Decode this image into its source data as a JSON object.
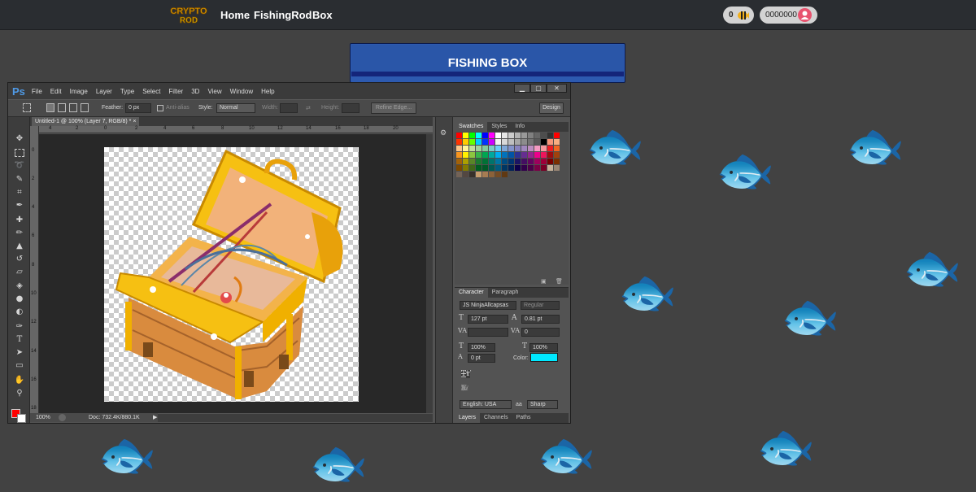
{
  "nav": {
    "logo_text": "CRYPTO ROD",
    "links": [
      "Home",
      "FishingRod",
      "Box"
    ],
    "fish_count": "0",
    "balance": "0000000"
  },
  "banner": {
    "title": "FISHING BOX"
  },
  "photoshop": {
    "logo": "Ps",
    "menu": [
      "File",
      "Edit",
      "Image",
      "Layer",
      "Type",
      "Select",
      "Filter",
      "3D",
      "View",
      "Window",
      "Help"
    ],
    "window_buttons": [
      "▁",
      "▢",
      "✕"
    ],
    "options": {
      "feather_label": "Feather:",
      "feather_value": "0 px",
      "antialias_label": "Anti-alias",
      "style_label": "Style:",
      "style_value": "Normal",
      "width_label": "Width:",
      "height_label": "Height:",
      "refine_button": "Refine Edge...",
      "workspace": "Design"
    },
    "doc_tab": "Untitled-1 @ 100% (Layer 7, RGB/8) *",
    "ruler_h": [
      "4",
      "2",
      "0",
      "2",
      "4",
      "6",
      "8",
      "10",
      "12",
      "14",
      "16",
      "18",
      "20"
    ],
    "ruler_v": [
      "0",
      "2",
      "4",
      "6",
      "8",
      "10",
      "12",
      "14",
      "16",
      "18"
    ],
    "status": {
      "zoom": "100%",
      "doc": "Doc: 732.4K/880.1K"
    },
    "swatches_tabs": [
      "Swatches",
      "Styles",
      "Info"
    ],
    "character_tabs": [
      "Character",
      "Paragraph"
    ],
    "character": {
      "font_family": "JS NinjaAllcapsas",
      "font_style": "Regular",
      "size": "127 pt",
      "leading": "0.81 pt",
      "kerning": "",
      "tracking": "0",
      "vscale": "100%",
      "hscale": "100%",
      "baseline": "0 pt",
      "color_label": "Color:",
      "color": "#00e8ff",
      "language": "English: USA",
      "antialias": "Sharp"
    },
    "layers_tabs": [
      "Layers",
      "Channels",
      "Paths"
    ],
    "swatch_colors": [
      "#ff0000",
      "#ffff00",
      "#00ff00",
      "#00ffff",
      "#0000ff",
      "#ff00ff",
      "#ffffff",
      "#e6e6e6",
      "#cccccc",
      "#b3b3b3",
      "#999999",
      "#808080",
      "#666666",
      "#4d4d4d",
      "#333333",
      "#ff0000",
      "#ff3300",
      "#ffcc00",
      "#66ff00",
      "#00ccff",
      "#0033ff",
      "#cc00ff",
      "#f2f2f2",
      "#d9d9d9",
      "#bfbfbf",
      "#a6a6a6",
      "#8c8c8c",
      "#737373",
      "#595959",
      "#000000",
      "#f7977a",
      "#f9ad81",
      "#fdc68a",
      "#fff79a",
      "#c4df9b",
      "#a3d39c",
      "#82ca9d",
      "#7bcdc8",
      "#6ecff6",
      "#7ea7d8",
      "#8493ca",
      "#8882be",
      "#a187be",
      "#bc8dbf",
      "#f49ac2",
      "#f6989d",
      "#ed1c24",
      "#f26522",
      "#f7941d",
      "#fff200",
      "#8dc73f",
      "#39b54a",
      "#00a651",
      "#00a99d",
      "#00aeef",
      "#0072bc",
      "#0054a6",
      "#2e3192",
      "#662d91",
      "#92278f",
      "#ec008c",
      "#ed145b",
      "#9e0b0f",
      "#a0410d",
      "#a36209",
      "#aba000",
      "#598527",
      "#1a7b30",
      "#007236",
      "#00746b",
      "#0076a3",
      "#004b80",
      "#003471",
      "#1b1464",
      "#440e62",
      "#630460",
      "#9e005d",
      "#9e0039",
      "#790000",
      "#7b2e00",
      "#7d4900",
      "#827b00",
      "#406618",
      "#005e20",
      "#005826",
      "#005952",
      "#005b7f",
      "#003663",
      "#002157",
      "#0d004c",
      "#32004b",
      "#4b0049",
      "#7b0046",
      "#7a0026",
      "#c7b299",
      "#998675",
      "#736357",
      "#534741",
      "#37302a",
      "#c69c6d",
      "#a67c52",
      "#8c6239",
      "#754c24",
      "#603913"
    ]
  }
}
